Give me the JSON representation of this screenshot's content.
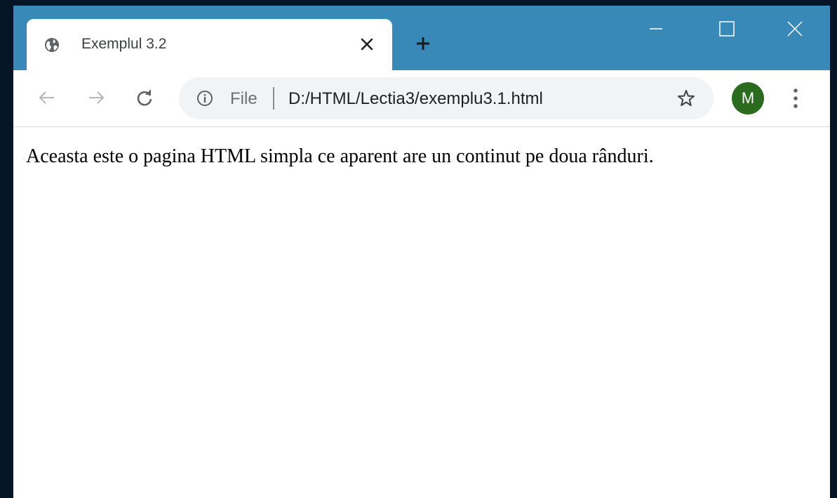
{
  "tab": {
    "title": "Exemplul 3.2",
    "favicon_icon": "globe-icon"
  },
  "toolbar": {
    "scheme_label": "File",
    "url": "D:/HTML/Lectia3/exemplu3.1.html",
    "profile_initial": "M"
  },
  "page": {
    "text": "Aceasta este o pagina HTML simpla ce aparent are un continut pe doua rânduri."
  },
  "colors": {
    "titlebar": "#3888b8",
    "desktop": "#051526",
    "avatar": "#2b6b1f"
  }
}
